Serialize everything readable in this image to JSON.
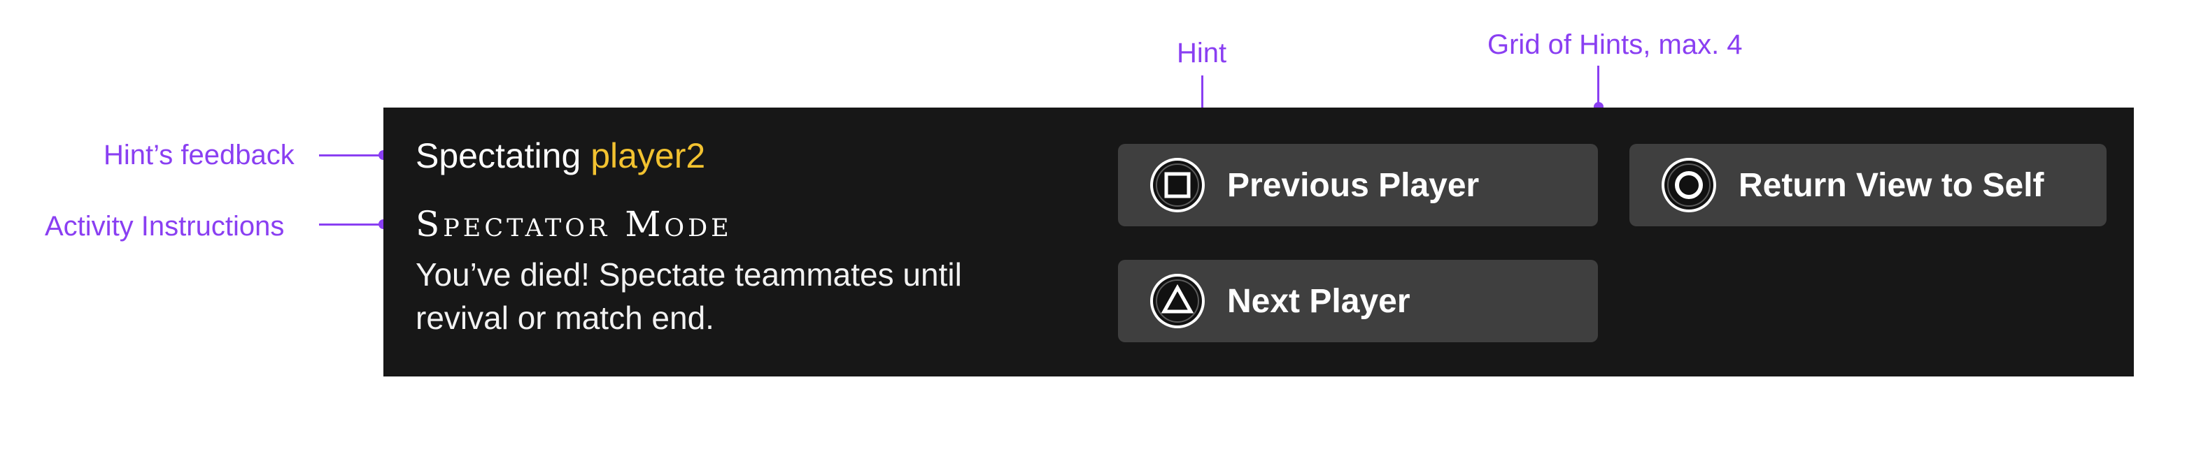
{
  "annotations": {
    "hint": "Hint",
    "grid": "Grid of Hints, max. 4",
    "feedback": "Hint’s feedback",
    "instructions": "Activity Instructions"
  },
  "feedback": {
    "prefix": "Spectating",
    "player": "player2"
  },
  "activity": {
    "title": "Spectator Mode",
    "body": "You’ve died! Spectate teammates until revival or match end."
  },
  "hints": [
    {
      "label": "Previous Player",
      "button": "square-icon"
    },
    {
      "label": "Return View to Self",
      "button": "circle-icon"
    },
    {
      "label": "Next Player",
      "button": "triangle-icon"
    }
  ],
  "colors": {
    "annotation": "#8a3ff2",
    "panel": "#171717",
    "hint_bg": "#3f3f3f",
    "player_highlight": "#f2c230",
    "text": "#ffffff"
  }
}
